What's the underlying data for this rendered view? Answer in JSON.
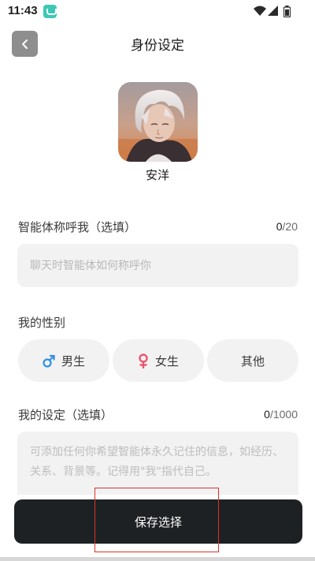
{
  "status_bar": {
    "time": "11:43"
  },
  "header": {
    "title": "身份设定"
  },
  "profile": {
    "name": "安洋"
  },
  "nickname": {
    "label": "智能体称呼我（选填）",
    "count": "0",
    "max": "/20",
    "placeholder": "聊天时智能体如何称呼你"
  },
  "gender": {
    "label": "我的性别",
    "options": [
      {
        "label": "男生",
        "icon": "male-icon",
        "color": "#2f8fe6"
      },
      {
        "label": "女生",
        "icon": "female-icon",
        "color": "#e8566f"
      },
      {
        "label": "其他"
      }
    ]
  },
  "setting": {
    "label": "我的设定（选填）",
    "count": "0",
    "max": "/1000",
    "placeholder": "可添加任何你希望智能体永久记住的信息，如经历、关系、背景等。记得用\"我\"指代自己。"
  },
  "save": {
    "label": "保存选择"
  }
}
